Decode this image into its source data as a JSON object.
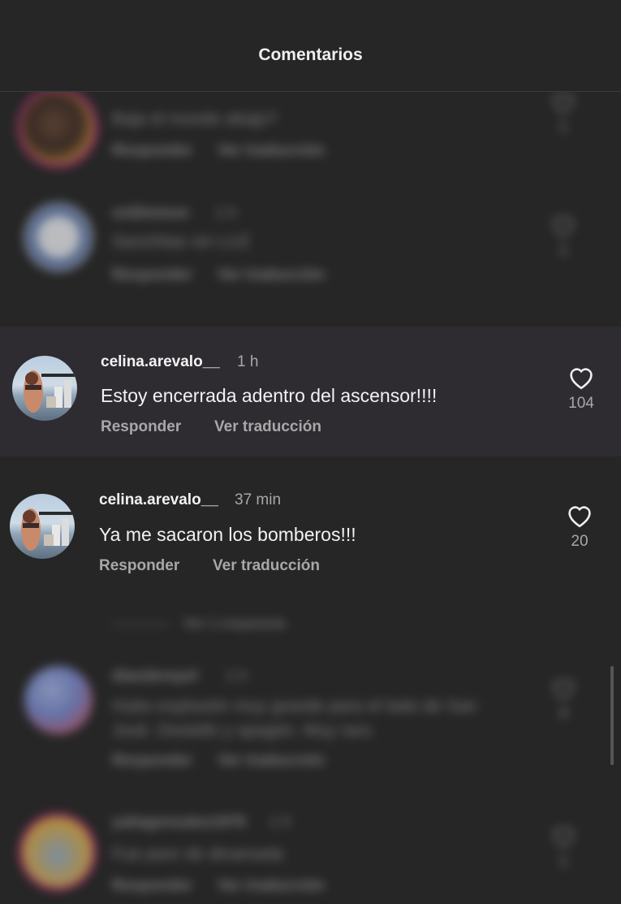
{
  "header": {
    "title": "Comentarios"
  },
  "comments": [
    {
      "username": "",
      "time": "",
      "text": "Baja el mundo abajo?",
      "reply_label": "Responder",
      "translate_label": "Ver traducción",
      "likes": "1"
    },
    {
      "username": "sn0lmmon",
      "time": "1 h",
      "text": "Sanchitas sin LUZ",
      "reply_label": "Responder",
      "translate_label": "Ver traducción",
      "likes": "1"
    },
    {
      "username": "celina.arevalo__",
      "time": "1 h",
      "text": "Estoy encerrada adentro del ascensor!!!!",
      "reply_label": "Responder",
      "translate_label": "Ver traducción",
      "likes": "104"
    },
    {
      "username": "celina.arevalo__",
      "time": "37 min",
      "text": "Ya me sacaron los bomberos!!!",
      "reply_label": "Responder",
      "translate_label": "Ver traducción",
      "likes": "20"
    },
    {
      "username": "dianderayel",
      "time": "1 h",
      "text_line1": "Hubo explosión muy grande para el lado de San",
      "text_line2": "José. Destello y apagón. Muy raro.",
      "reply_label": "Responder",
      "translate_label": "Ver traducción",
      "likes": "4"
    },
    {
      "username": "yaliagonzalez1976",
      "time": "1 h",
      "text": "Fue peor de dinamada",
      "reply_label": "Responder",
      "translate_label": "Ver traducción",
      "likes": "1"
    }
  ],
  "view_replies": {
    "label": "Ver 1 respuesta"
  },
  "colors": {
    "background": "#262626",
    "highlight_row": "#2e2b31",
    "primary_text": "#f2f2f2",
    "secondary_text": "#a8a8a8",
    "story_ring": "#b6307a"
  }
}
